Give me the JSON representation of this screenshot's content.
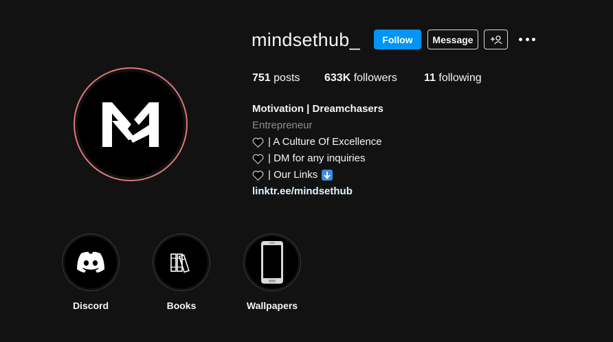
{
  "profile": {
    "username": "mindsethub_",
    "avatar_icon": "mindsethub-logo-icon"
  },
  "actions": {
    "follow_label": "Follow",
    "message_label": "Message",
    "suggest_icon": "add-person-icon",
    "more_icon": "more-options-icon"
  },
  "stats": {
    "posts_count": "751",
    "posts_label": "posts",
    "followers_count": "633K",
    "followers_label": "followers",
    "following_count": "11",
    "following_label": "following"
  },
  "bio": {
    "name": "Motivation | Dreamchasers",
    "category": "Entrepreneur",
    "lines": [
      "| A Culture Of Excellence",
      "| DM for any inquiries",
      "| Our Links"
    ],
    "link": "linktr.ee/mindsethub"
  },
  "highlights": [
    {
      "label": "Discord",
      "icon": "discord-icon"
    },
    {
      "label": "Books",
      "icon": "books-icon"
    },
    {
      "label": "Wallpapers",
      "icon": "phone-icon"
    }
  ],
  "colors": {
    "background": "#121212",
    "follow_button": "#0095f6",
    "avatar_ring": "#e0787a",
    "category_text": "#8e8e8e",
    "link_text": "#e0f1ff"
  }
}
